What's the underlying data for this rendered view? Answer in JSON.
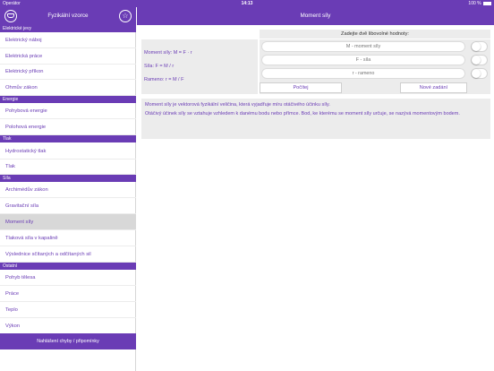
{
  "statusbar": {
    "carrier": "Operátor",
    "time": "14:13",
    "battery": "100 %"
  },
  "sidebar": {
    "title": "Fyzikální vzorce",
    "sections": [
      {
        "label": "Elektrické jevy",
        "items": [
          "Elektrický náboj",
          "Elektrická práce",
          "Elektrický příkon",
          "Ohmův zákon"
        ]
      },
      {
        "label": "Energie",
        "items": [
          "Pohybová energie",
          "Polohová energie"
        ]
      },
      {
        "label": "Tlak",
        "items": [
          "Hydrostatický tlak",
          "Tlak"
        ]
      },
      {
        "label": "Síla",
        "items": [
          "Archimédův zákon",
          "Gravitační síla",
          "Moment síly",
          "Tlaková síla v kapalině",
          "Výslednice sčítaných a odčítaných sil"
        ]
      },
      {
        "label": "Ostatní",
        "items": [
          "Pohyb tělesa",
          "Práce",
          "Teplo",
          "Výkon"
        ]
      }
    ],
    "report_label": "Nahlášení chyby / připomínky"
  },
  "main": {
    "title": "Moment síly",
    "prompt": "Zadejte dvě libovolné hodnoty:",
    "formulas": [
      "Moment síly: M = F · r",
      "Síla: F = M / r",
      "Rameno: r = M / F"
    ],
    "fields": [
      {
        "placeholder": "M - moment síly"
      },
      {
        "placeholder": "F - síla"
      },
      {
        "placeholder": "r - rameno"
      }
    ],
    "toggles": [
      false,
      false,
      false
    ],
    "compute_label": "Počítej",
    "new_label": "Nové zadání",
    "description": [
      "Moment síly je vektorová fyzikální veličina, která vyjadřuje míru otáčivého účinku síly.",
      "Otáčivý účinek síly se vztahuje vzhledem k danému bodu nebo přímce. Bod, ke kterému se moment síly určuje, se nazývá momentovým bodem."
    ]
  },
  "colors": {
    "accent": "#6a3cb5",
    "panel": "#ececec",
    "selected": "#d8d8d8"
  }
}
